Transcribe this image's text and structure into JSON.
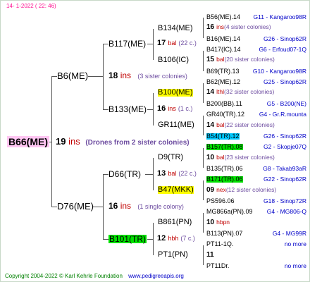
{
  "header": {
    "date": "14-  1-2022 ( 22:  46)"
  },
  "root": {
    "id": "B66(ME)",
    "gen": "19",
    "suffix": "ins",
    "info": "(Drones from 2 sister colonies)"
  },
  "gen1": {
    "upper": {
      "id": "B6(ME)"
    },
    "lower": {
      "id": "D76(ME)"
    }
  },
  "gen2": [
    {
      "id": "B117(ME)"
    },
    {
      "id": "B133(ME)"
    },
    {
      "id": "D66(TR)"
    },
    {
      "id": "B101(TR)"
    }
  ],
  "gen2_info": [
    {
      "num": "18",
      "suffix": "ins",
      "note": "(3 sister colonies)"
    },
    {
      "num": "16",
      "suffix": "ins",
      "note": "(1 single colony)"
    }
  ],
  "gen3": [
    {
      "id": "B134(ME)"
    },
    {
      "id": "B106(IC)"
    },
    {
      "id": "B100(ME)"
    },
    {
      "id": "GR11(ME)"
    },
    {
      "id": "D9(TR)"
    },
    {
      "id": "B47(MKK)"
    },
    {
      "id": "B861(PN)"
    },
    {
      "id": "PT1(PN)"
    }
  ],
  "gen3_info": [
    {
      "num": "17",
      "suffix": "bal",
      "note": "(22 c.)"
    },
    {
      "num": "16",
      "suffix": "ins",
      "note": "(1 c.)"
    },
    {
      "num": "13",
      "suffix": "bal",
      "note": "(22 c.)"
    },
    {
      "num": "12",
      "suffix": "hbh",
      "note": "(7 c.)"
    }
  ],
  "gen4": [
    {
      "id": "B56(ME).14",
      "src": "G11 - Kangaroo98R"
    },
    {
      "num": "16",
      "suffix": "ins",
      "note": "(4 sister colonies)"
    },
    {
      "id": "B16(ME).14",
      "src": "G26 - Sinop62R"
    },
    {
      "id": "B417(IC).14",
      "src": "G6 - Erfoud07-1Q"
    },
    {
      "num": "15",
      "suffix": "bal",
      "note": "(20 sister colonies)"
    },
    {
      "id": "B69(TR).13",
      "src": "G10 - Kangaroo98R"
    },
    {
      "id": "B62(ME).12",
      "src": "G25 - Sinop62R"
    },
    {
      "num": "14",
      "suffix": "lthl",
      "note": "(32 sister colonies)"
    },
    {
      "id": "B200(BB).11",
      "src": "G5 - B200(NE)"
    },
    {
      "id": "GR40(TR).12",
      "src": "G4 - Gr.R.mounta"
    },
    {
      "num": "14",
      "suffix": "bal",
      "note": "(22 sister colonies)"
    },
    {
      "id": "B54(TR).12",
      "src": "G26 - Sinop62R"
    },
    {
      "id": "B157(TR).08",
      "src": "G2 - Skopje07Q"
    },
    {
      "num": "10",
      "suffix": "bal",
      "note": "(23 sister colonies)"
    },
    {
      "id": "B135(TR).06",
      "src": "G8 - Takab93aR"
    },
    {
      "id": "B171(TR).06",
      "src": "G22 - Sinop62R"
    },
    {
      "num": "09",
      "suffix": "nex",
      "note": "(12 sister colonies)"
    },
    {
      "id": "PS596.06",
      "src": "G18 - Sinop72R"
    },
    {
      "id": "MG866a(PN).09",
      "src": "G4 - MG806-Q"
    },
    {
      "num": "10",
      "suffix": "hbpn",
      "note": ""
    },
    {
      "id": "B113(PN).07",
      "src": "G4 - MG99R"
    },
    {
      "id": "PT11-1Q.",
      "src": "no more"
    },
    {
      "num": "11",
      "suffix": "",
      "note": ""
    },
    {
      "id": "PT11Dr.",
      "src": "no more"
    }
  ],
  "footer": {
    "copyright": "Copyright 2004-2022 © Karl Kehrle Foundation",
    "url": "www.pedigreeapis.org"
  },
  "colors": {
    "highlight_yellow": "#ffff00",
    "highlight_green": "#00e000",
    "highlight_cyan": "#00c8ff",
    "root_bg": "#ffc6f2",
    "source_blue": "#0000c8",
    "suffix_red": "#c00000"
  }
}
